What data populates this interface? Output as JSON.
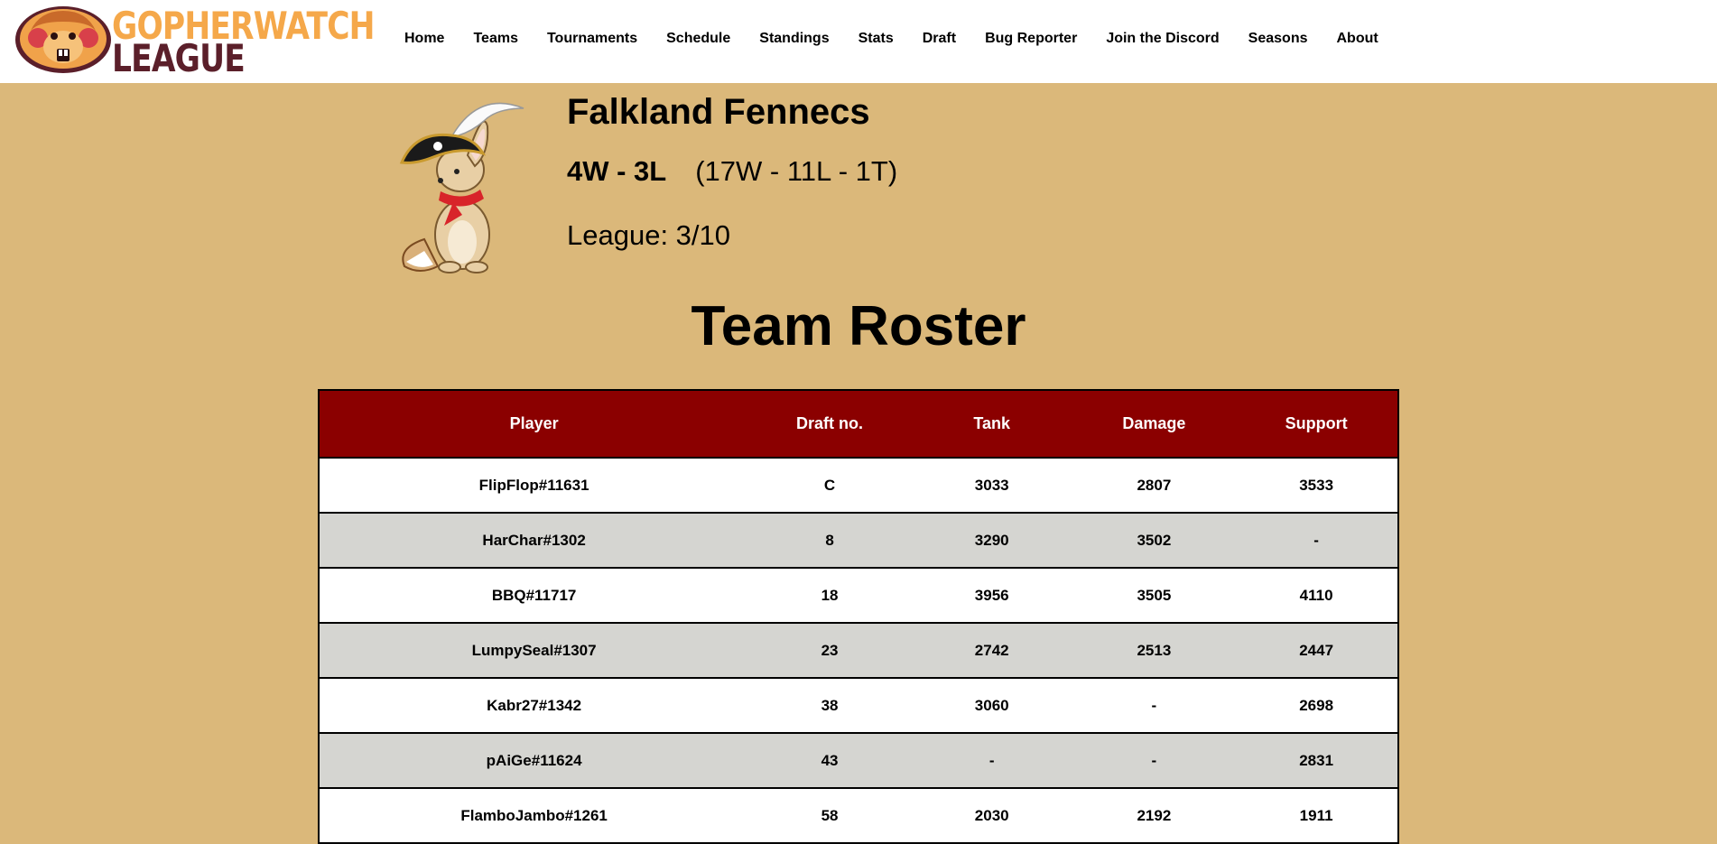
{
  "brand": {
    "line1": "GOPHERWATCH",
    "line2": "LEAGUE",
    "accent_color": "#f5a84a",
    "dark_color": "#5b1f2a"
  },
  "nav": {
    "items": [
      {
        "label": "Home"
      },
      {
        "label": "Teams"
      },
      {
        "label": "Tournaments"
      },
      {
        "label": "Schedule"
      },
      {
        "label": "Standings"
      },
      {
        "label": "Stats"
      },
      {
        "label": "Draft"
      },
      {
        "label": "Bug Reporter"
      },
      {
        "label": "Join the Discord"
      },
      {
        "label": "Seasons"
      },
      {
        "label": "About"
      }
    ]
  },
  "team": {
    "name": "Falkland Fennecs",
    "record": "4W - 3L",
    "overall_record": "(17W - 11L - 1T)",
    "league_rank": "League: 3/10",
    "logo_icon": "pirate-fennec-fox-icon"
  },
  "roster": {
    "title": "Team Roster",
    "header_color": "#8b0000",
    "row_alt_color": "#d5d5d1",
    "columns": [
      "Player",
      "Draft no.",
      "Tank",
      "Damage",
      "Support"
    ],
    "rows": [
      [
        "FlipFlop#11631",
        "C",
        "3033",
        "2807",
        "3533"
      ],
      [
        "HarChar#1302",
        "8",
        "3290",
        "3502",
        "-"
      ],
      [
        "BBQ#11717",
        "18",
        "3956",
        "3505",
        "4110"
      ],
      [
        "LumpySeal#1307",
        "23",
        "2742",
        "2513",
        "2447"
      ],
      [
        "Kabr27#1342",
        "38",
        "3060",
        "-",
        "2698"
      ],
      [
        "pAiGe#11624",
        "43",
        "-",
        "-",
        "2831"
      ],
      [
        "FlamboJambo#1261",
        "58",
        "2030",
        "2192",
        "1911"
      ]
    ]
  }
}
